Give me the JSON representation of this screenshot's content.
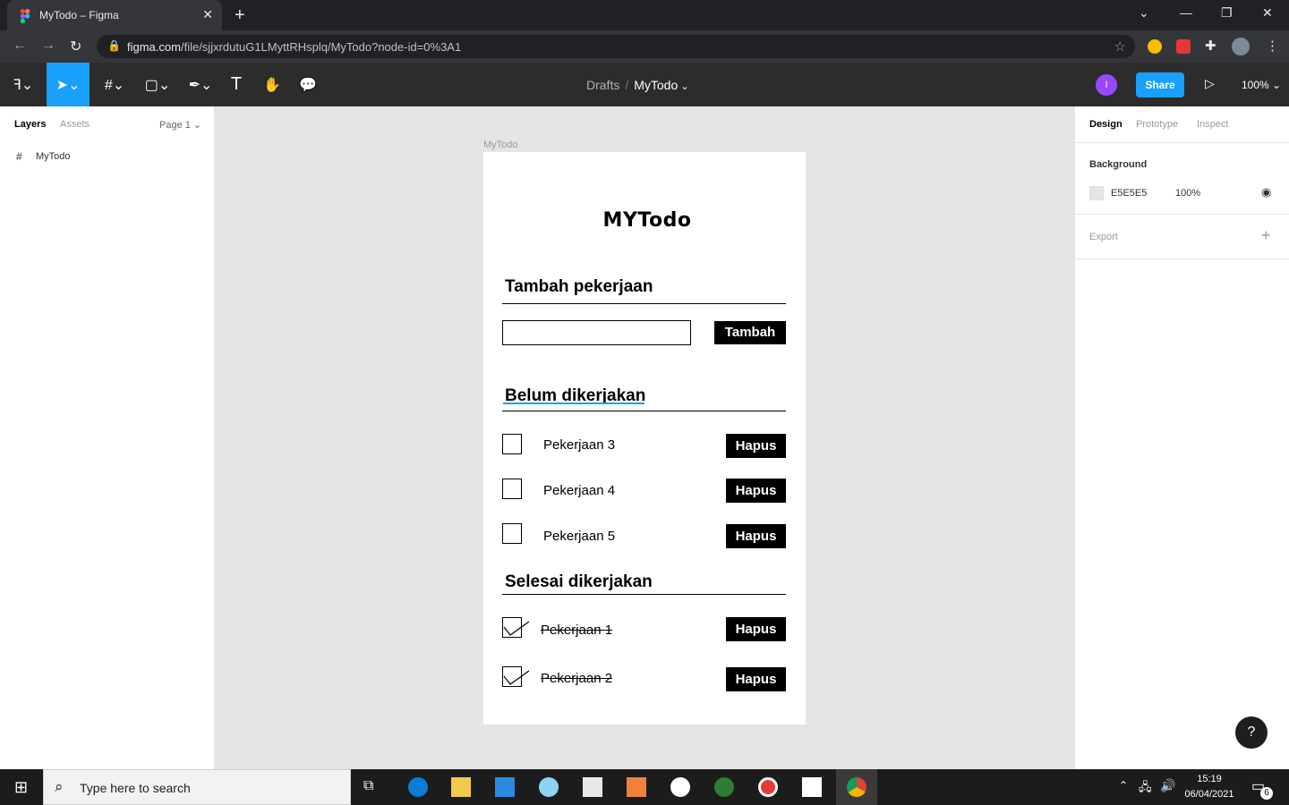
{
  "browser": {
    "tab_title": "MyTodo – Figma",
    "url_domain": "figma.com",
    "url_path": "/file/sjjxrdutuG1LMyttRHsplq/MyTodo?node-id=0%3A1"
  },
  "toolbar": {
    "breadcrumb_parent": "Drafts",
    "breadcrumb_sep": "/",
    "file_name": "MyTodo",
    "avatar_initial": "I",
    "share_label": "Share",
    "zoom_level": "100%"
  },
  "left_panel": {
    "tabs": [
      "Layers",
      "Assets"
    ],
    "page_selector": "Page 1",
    "layers": [
      {
        "name": "MyTodo"
      }
    ]
  },
  "canvas": {
    "frame_label": "MyTodo",
    "app_title": "MYTodo",
    "add_section_title": "Tambah pekerjaan",
    "input_value": "",
    "add_button": "Tambah",
    "pending_section_title": "Belum dikerjakan",
    "pending_items": [
      {
        "label": "Pekerjaan 3",
        "delete": "Hapus"
      },
      {
        "label": "Pekerjaan 4",
        "delete": "Hapus"
      },
      {
        "label": "Pekerjaan 5",
        "delete": "Hapus"
      }
    ],
    "done_section_title": "Selesai dikerjakan",
    "done_items": [
      {
        "label": "Pekerjaan 1",
        "delete": "Hapus"
      },
      {
        "label": "Pekerjaan 2",
        "delete": "Hapus"
      }
    ]
  },
  "right_panel": {
    "tabs": [
      "Design",
      "Prototype",
      "Inspect"
    ],
    "background_label": "Background",
    "background_hex": "E5E5E5",
    "background_opacity": "100%",
    "export_label": "Export"
  },
  "help": "?",
  "taskbar": {
    "search_placeholder": "Type here to search",
    "time": "15:19",
    "date": "06/04/2021",
    "notification_count": "6"
  },
  "colors": {
    "accent": "#18a0fb",
    "canvas_bg": "#e5e5e5",
    "avatar": "#9747ff"
  }
}
